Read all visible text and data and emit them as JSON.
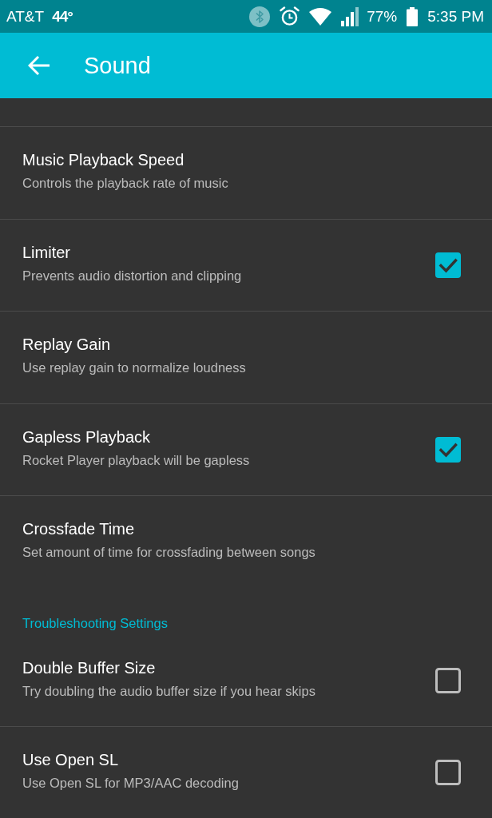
{
  "status_bar": {
    "carrier": "AT&T",
    "temperature": "44°",
    "battery": "77%",
    "time": "5:35 PM"
  },
  "app_bar": {
    "title": "Sound"
  },
  "sections": [
    {
      "items": [
        {
          "kind": "plain",
          "title": "Music Playback Speed",
          "subtitle": "Controls the playback rate of music"
        },
        {
          "kind": "checkbox",
          "title": "Limiter",
          "subtitle": "Prevents audio distortion and clipping",
          "checked": true
        },
        {
          "kind": "plain",
          "title": "Replay Gain",
          "subtitle": "Use replay gain to normalize loudness"
        },
        {
          "kind": "checkbox",
          "title": "Gapless Playback",
          "subtitle": "Rocket Player playback will be gapless",
          "checked": true
        },
        {
          "kind": "plain",
          "title": "Crossfade Time",
          "subtitle": "Set amount of time for crossfading between songs"
        }
      ]
    },
    {
      "header": "Troubleshooting Settings",
      "items": [
        {
          "kind": "checkbox",
          "title": "Double Buffer Size",
          "subtitle": "Try doubling the audio buffer size if you hear skips",
          "checked": false
        },
        {
          "kind": "checkbox",
          "title": "Use Open SL",
          "subtitle": "Use Open SL for MP3/AAC decoding",
          "checked": false
        }
      ]
    }
  ]
}
